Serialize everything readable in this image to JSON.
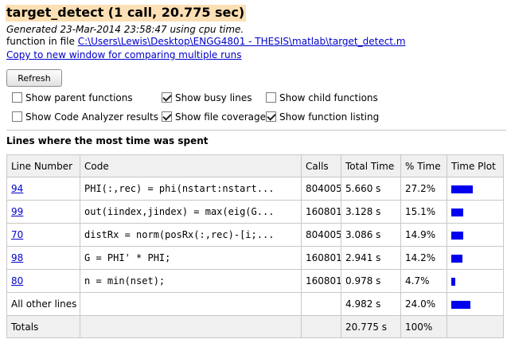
{
  "header": {
    "title": "target_detect (1 call, 20.775 sec)",
    "generated": "Generated 23-Mar-2014 23:58:47 using cpu time.",
    "file_prefix": "function in file ",
    "file_path": "C:\\Users\\Lewis\\Desktop\\ENGG4801 - THESIS\\matlab\\target_detect.m",
    "copy_link": "Copy to new window for comparing multiple runs"
  },
  "toolbar": {
    "refresh_label": "Refresh"
  },
  "options": {
    "parent": {
      "label": "Show parent functions",
      "checked": false
    },
    "busy": {
      "label": "Show busy lines",
      "checked": true
    },
    "child": {
      "label": "Show child functions",
      "checked": false
    },
    "analyzer": {
      "label": "Show Code Analyzer results",
      "checked": false
    },
    "coverage": {
      "label": "Show file coverage",
      "checked": true
    },
    "listing": {
      "label": "Show function listing",
      "checked": true
    }
  },
  "section_title": "Lines where the most time was spent",
  "table": {
    "headers": {
      "line": "Line Number",
      "code": "Code",
      "calls": "Calls",
      "total_time": "Total Time",
      "pct": "% Time",
      "plot": "Time Plot"
    },
    "rows": [
      {
        "line": "94",
        "code": "PHI(:,rec) = phi(nstart:nstart...",
        "calls": "804005",
        "time": "5.660 s",
        "pct": "27.2%",
        "pct_value": 27.2
      },
      {
        "line": "99",
        "code": "out(iindex,jindex) = max(eig(G...",
        "calls": "160801",
        "time": "3.128 s",
        "pct": "15.1%",
        "pct_value": 15.1
      },
      {
        "line": "70",
        "code": "distRx = norm(posRx(:,rec)-[i;...",
        "calls": "804005",
        "time": "3.086 s",
        "pct": "14.9%",
        "pct_value": 14.9
      },
      {
        "line": "98",
        "code": "G = PHI' * PHI;",
        "calls": "160801",
        "time": "2.941 s",
        "pct": "14.2%",
        "pct_value": 14.2
      },
      {
        "line": "80",
        "code": "n = min(nset);",
        "calls": "160801",
        "time": "0.978 s",
        "pct": "4.7%",
        "pct_value": 4.7
      }
    ],
    "other": {
      "label": "All other lines",
      "time": "4.982 s",
      "pct": "24.0%",
      "pct_value": 24.0
    },
    "totals": {
      "label": "Totals",
      "time": "20.775 s",
      "pct": "100%"
    }
  },
  "colors": {
    "title_bg": "#fcdfb4",
    "bar": "#0000ee",
    "link": "#0000cc"
  }
}
